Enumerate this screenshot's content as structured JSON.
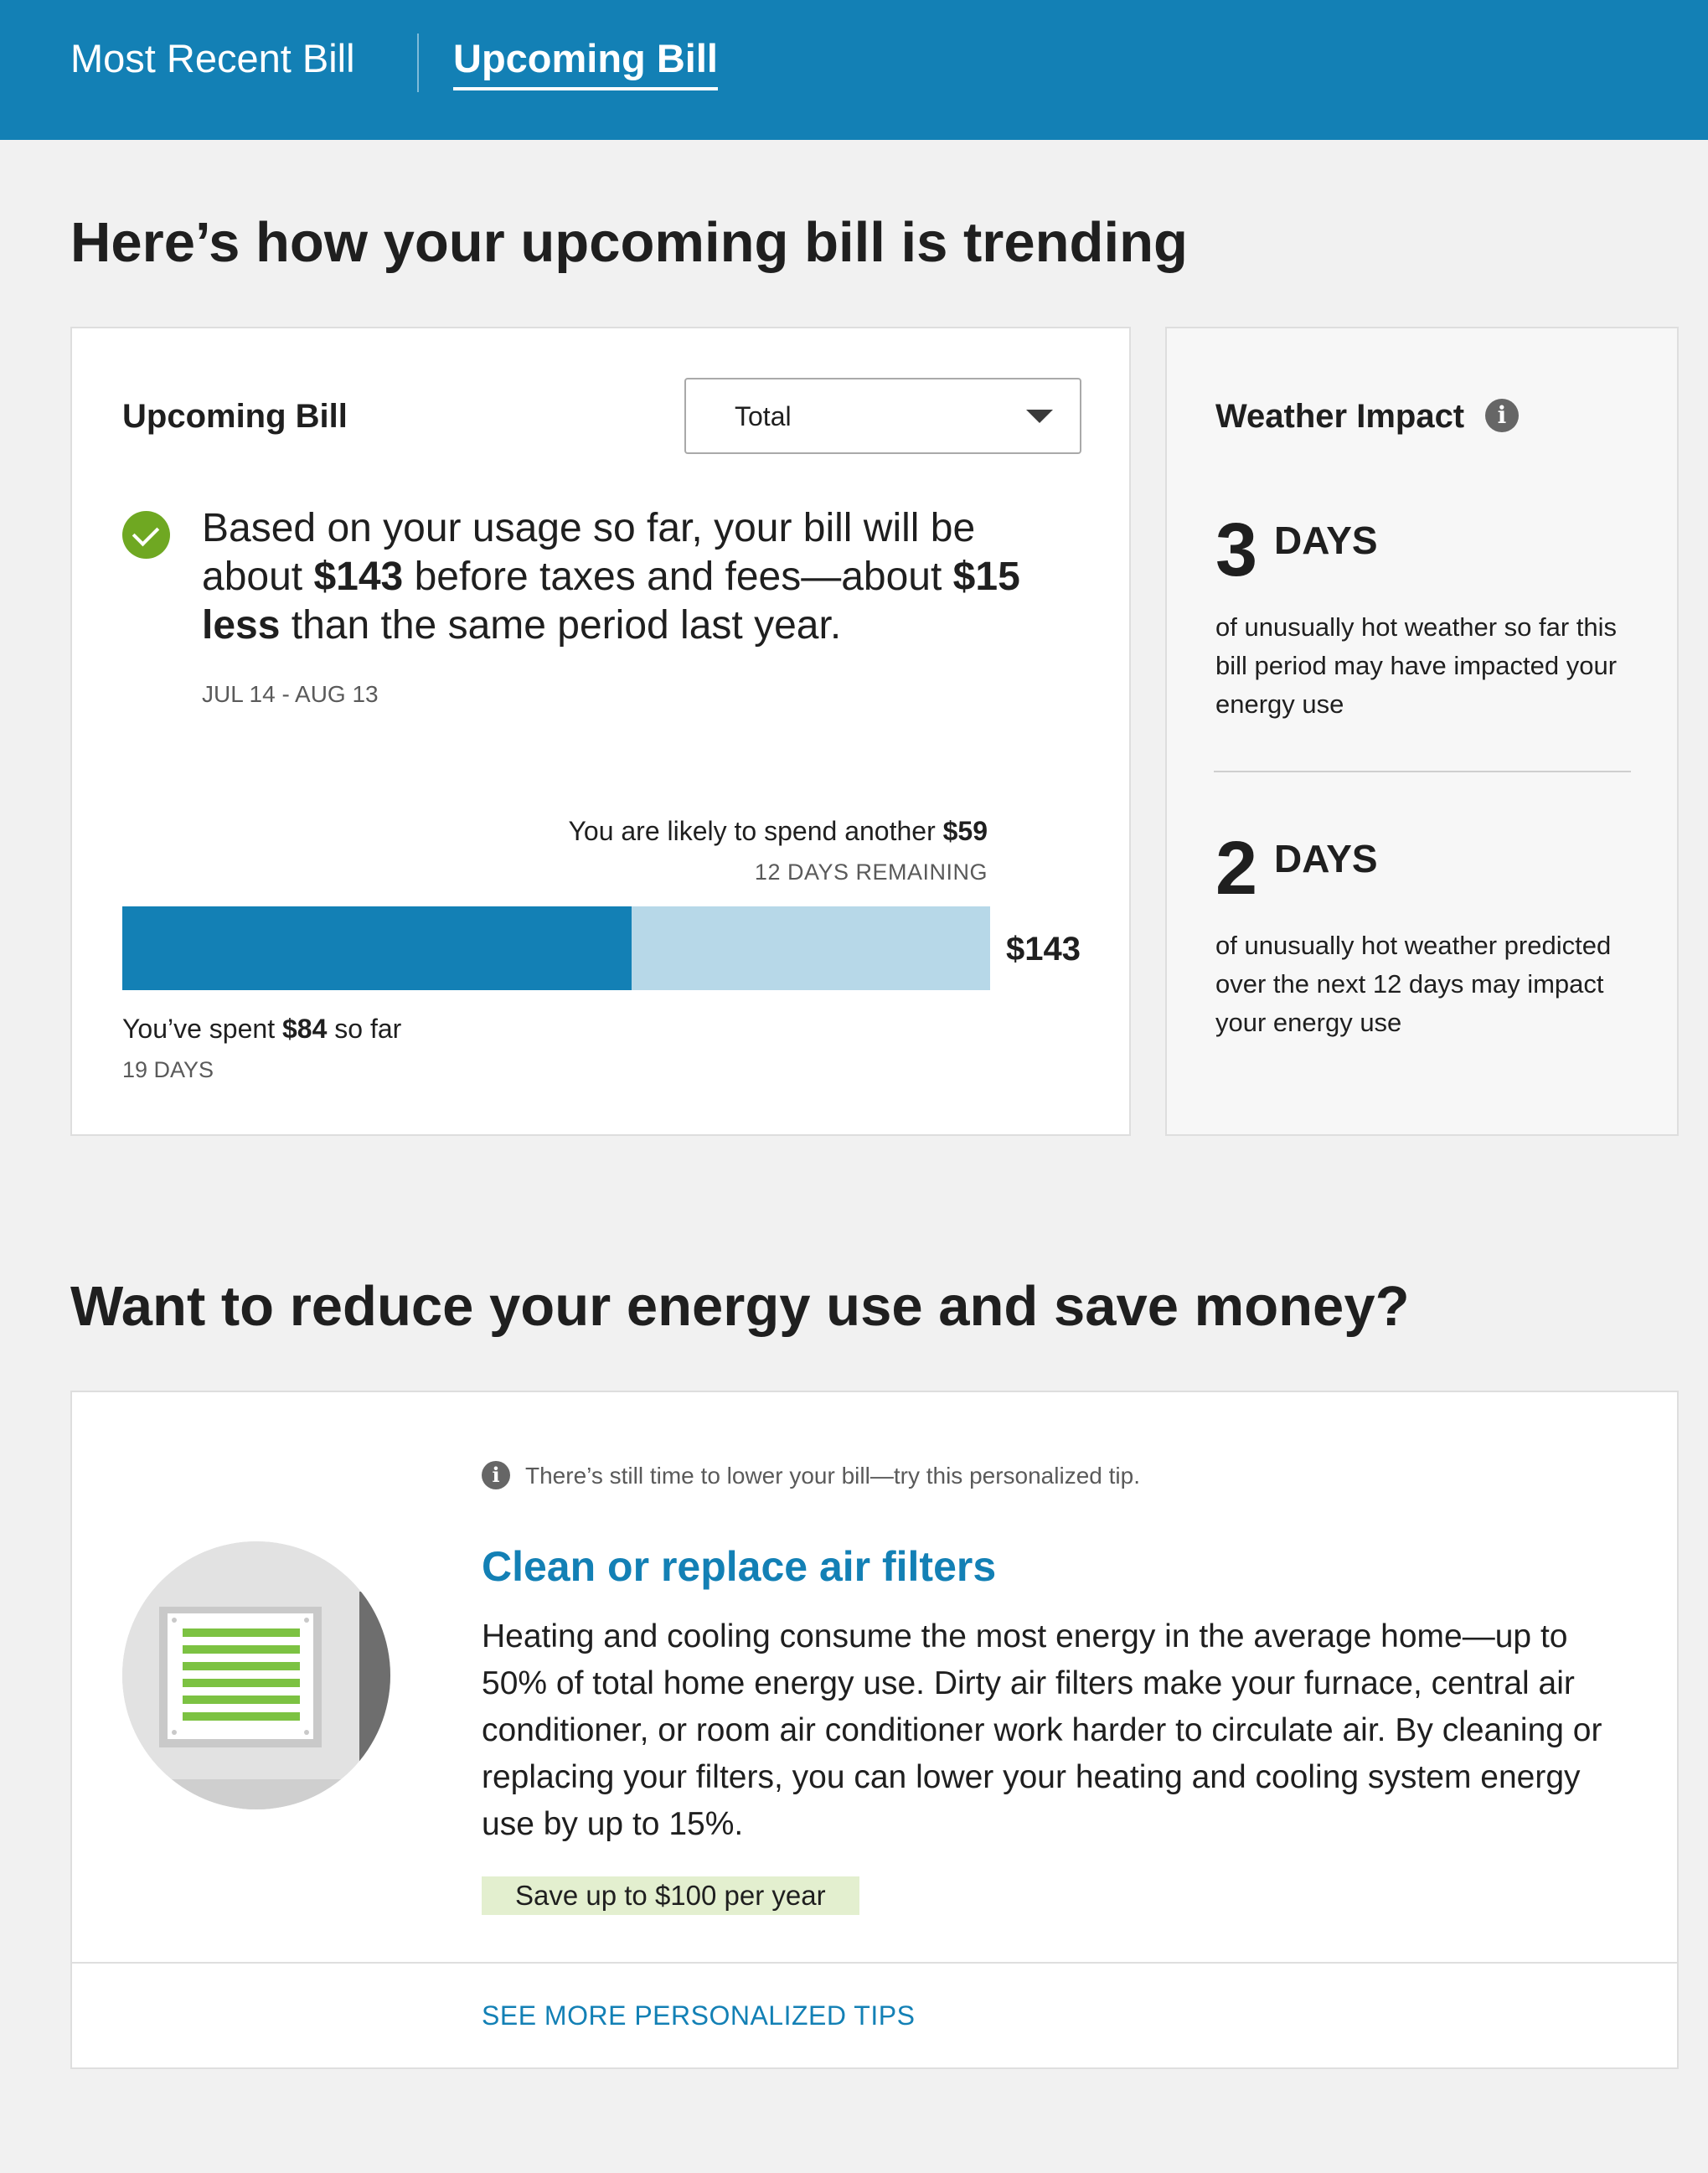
{
  "tabs": [
    {
      "label": "Most Recent Bill",
      "active": false
    },
    {
      "label": "Upcoming Bill",
      "active": true
    }
  ],
  "trend_heading": "Here’s how your upcoming bill is trending",
  "upcoming_bill": {
    "title": "Upcoming Bill",
    "select_value": "Total",
    "summary": {
      "part1": "Based on your usage so far, your bill will be about ",
      "amount": "$143",
      "part2": " before taxes and fees—about ",
      "diff": "$15 less",
      "part3": " than the same period last year."
    },
    "period": "JUL 14 - AUG 13",
    "forecast_prefix": "You are likely to spend another ",
    "forecast_amount": "$59",
    "remaining": "12 DAYS REMAINING",
    "bar_total": "$143",
    "spent_fraction": 0.587,
    "spent_prefix": "You’ve spent ",
    "spent_amount": "$84",
    "spent_suffix": " so far",
    "spent_days": "19 DAYS",
    "colors": {
      "spent": "#1380b5",
      "remaining": "#b7d8e8",
      "check": "#6fa822"
    }
  },
  "weather": {
    "title": "Weather Impact",
    "info_glyph": "i",
    "items": [
      {
        "number": "3",
        "unit": "DAYS",
        "text": "of unusually hot weather so far this bill period may have impacted your energy use"
      },
      {
        "number": "2",
        "unit": "DAYS",
        "text": "of unusually hot weather predicted over the next 12 days may impact your energy use"
      }
    ]
  },
  "save_heading": "Want to reduce your energy use and save money?",
  "tip": {
    "note": "There’s still time to lower your bill—try this personalized tip.",
    "title": "Clean or replace air filters",
    "body": "Heating and cooling consume the most energy in the average home—up to 50% of total home energy use. Dirty air filters make your furnace, central air conditioner, or room air conditioner work harder to circulate air. By cleaning or replacing your filters, you can lower your heating and cooling system energy use by up to 15%.",
    "badge": "Save up to $100 per year",
    "link": "SEE MORE PERSONALIZED TIPS",
    "illustration_icon": "air-filter-icon"
  }
}
